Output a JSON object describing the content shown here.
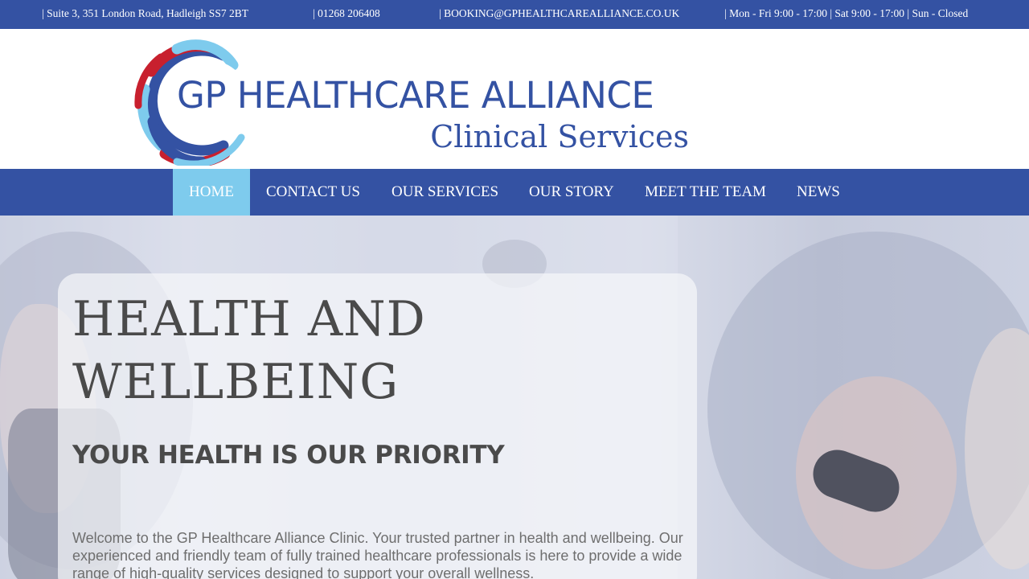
{
  "topbar": {
    "address": "| Suite 3, 351 London Road, Hadleigh SS7 2BT",
    "phone": "| 01268 206408",
    "email": "| BOOKING@GPHEALTHCAREALLIANCE.CO.UK",
    "hours": "| Mon - Fri 9:00 - 17:00 | Sat 9:00 - 17:00 | Sun - Closed"
  },
  "logo": {
    "title": "GP HEALTHCARE ALLIANCE",
    "subtitle": "Clinical Services"
  },
  "nav": {
    "items": [
      {
        "label": "HOME",
        "active": true
      },
      {
        "label": "CONTACT US"
      },
      {
        "label": "OUR SERVICES"
      },
      {
        "label": "OUR STORY"
      },
      {
        "label": "MEET THE TEAM"
      },
      {
        "label": "NEWS"
      }
    ]
  },
  "hero": {
    "title": "HEALTH AND WELLBEING",
    "subtitle": "YOUR HEALTH IS OUR PRIORITY",
    "text": "Welcome to the GP Healthcare Alliance Clinic. Your trusted partner in health and wellbeing. Our experienced and friendly team of fully trained healthcare professionals is here to provide a wide range of high-quality services designed to support your overall wellness."
  },
  "colors": {
    "brand_blue": "#3452a3",
    "active_nav": "#7ecbed",
    "logo_red": "#c8202e",
    "logo_light_blue": "#7ecbed"
  }
}
